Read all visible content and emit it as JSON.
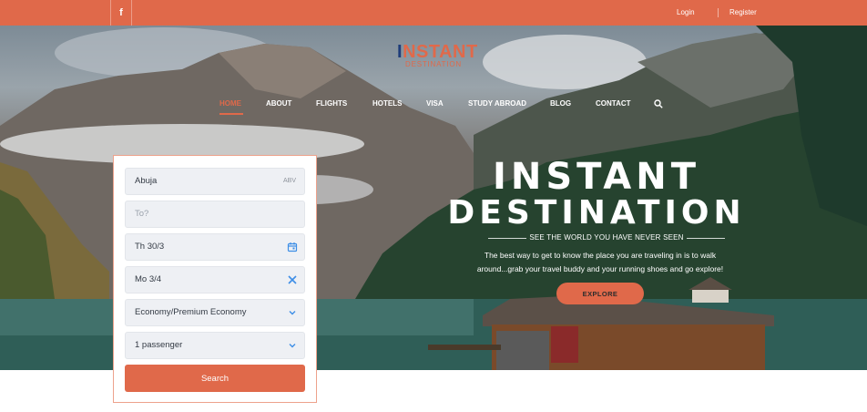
{
  "topbar": {
    "facebook_icon": "f",
    "login_label": "Login",
    "register_label": "Register"
  },
  "logo": {
    "line1_first": "I",
    "line1_rest": "NSTANT",
    "line2": "DESTINATION"
  },
  "nav": {
    "items": [
      "HOME",
      "ABOUT",
      "FLIGHTS",
      "HOTELS",
      "VISA",
      "STUDY ABROAD",
      "BLOG",
      "CONTACT"
    ],
    "active": "HOME",
    "search_icon": "search-icon"
  },
  "hero": {
    "title_line1": "INSTANT",
    "title_line2": "DESTINATION",
    "tagline": "SEE THE WORLD YOU HAVE NEVER SEEN",
    "description": "The best way to get to know the place you are traveling in is to walk around...grab your travel buddy and your running shoes and go explore!",
    "explore_label": "EXPLORE"
  },
  "search_form": {
    "from_value": "Abuja",
    "from_code": "ABV",
    "to_placeholder": "To?",
    "depart_value": "Th 30/3",
    "return_value": "Mo 3/4",
    "cabin_value": "Economy/Premium Economy",
    "passengers_value": "1 passenger",
    "search_label": "Search"
  },
  "colors": {
    "brand": "#e0694a",
    "logo_accent": "#1f3d7a",
    "field_bg": "#eef0f4",
    "icon_blue": "#3d8ee6"
  }
}
